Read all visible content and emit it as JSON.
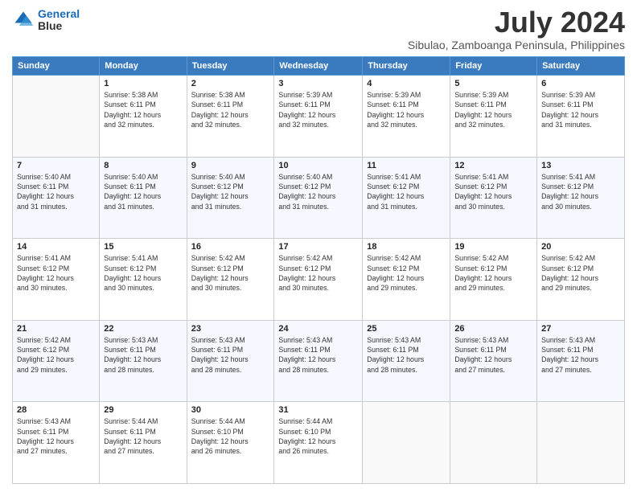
{
  "header": {
    "logo_line1": "General",
    "logo_line2": "Blue",
    "main_title": "July 2024",
    "subtitle": "Sibulao, Zamboanga Peninsula, Philippines"
  },
  "calendar": {
    "days_of_week": [
      "Sunday",
      "Monday",
      "Tuesday",
      "Wednesday",
      "Thursday",
      "Friday",
      "Saturday"
    ],
    "weeks": [
      [
        {
          "day": "",
          "info": ""
        },
        {
          "day": "1",
          "info": "Sunrise: 5:38 AM\nSunset: 6:11 PM\nDaylight: 12 hours\nand 32 minutes."
        },
        {
          "day": "2",
          "info": "Sunrise: 5:38 AM\nSunset: 6:11 PM\nDaylight: 12 hours\nand 32 minutes."
        },
        {
          "day": "3",
          "info": "Sunrise: 5:39 AM\nSunset: 6:11 PM\nDaylight: 12 hours\nand 32 minutes."
        },
        {
          "day": "4",
          "info": "Sunrise: 5:39 AM\nSunset: 6:11 PM\nDaylight: 12 hours\nand 32 minutes."
        },
        {
          "day": "5",
          "info": "Sunrise: 5:39 AM\nSunset: 6:11 PM\nDaylight: 12 hours\nand 32 minutes."
        },
        {
          "day": "6",
          "info": "Sunrise: 5:39 AM\nSunset: 6:11 PM\nDaylight: 12 hours\nand 31 minutes."
        }
      ],
      [
        {
          "day": "7",
          "info": "Sunrise: 5:40 AM\nSunset: 6:11 PM\nDaylight: 12 hours\nand 31 minutes."
        },
        {
          "day": "8",
          "info": "Sunrise: 5:40 AM\nSunset: 6:11 PM\nDaylight: 12 hours\nand 31 minutes."
        },
        {
          "day": "9",
          "info": "Sunrise: 5:40 AM\nSunset: 6:12 PM\nDaylight: 12 hours\nand 31 minutes."
        },
        {
          "day": "10",
          "info": "Sunrise: 5:40 AM\nSunset: 6:12 PM\nDaylight: 12 hours\nand 31 minutes."
        },
        {
          "day": "11",
          "info": "Sunrise: 5:41 AM\nSunset: 6:12 PM\nDaylight: 12 hours\nand 31 minutes."
        },
        {
          "day": "12",
          "info": "Sunrise: 5:41 AM\nSunset: 6:12 PM\nDaylight: 12 hours\nand 30 minutes."
        },
        {
          "day": "13",
          "info": "Sunrise: 5:41 AM\nSunset: 6:12 PM\nDaylight: 12 hours\nand 30 minutes."
        }
      ],
      [
        {
          "day": "14",
          "info": "Sunrise: 5:41 AM\nSunset: 6:12 PM\nDaylight: 12 hours\nand 30 minutes."
        },
        {
          "day": "15",
          "info": "Sunrise: 5:41 AM\nSunset: 6:12 PM\nDaylight: 12 hours\nand 30 minutes."
        },
        {
          "day": "16",
          "info": "Sunrise: 5:42 AM\nSunset: 6:12 PM\nDaylight: 12 hours\nand 30 minutes."
        },
        {
          "day": "17",
          "info": "Sunrise: 5:42 AM\nSunset: 6:12 PM\nDaylight: 12 hours\nand 30 minutes."
        },
        {
          "day": "18",
          "info": "Sunrise: 5:42 AM\nSunset: 6:12 PM\nDaylight: 12 hours\nand 29 minutes."
        },
        {
          "day": "19",
          "info": "Sunrise: 5:42 AM\nSunset: 6:12 PM\nDaylight: 12 hours\nand 29 minutes."
        },
        {
          "day": "20",
          "info": "Sunrise: 5:42 AM\nSunset: 6:12 PM\nDaylight: 12 hours\nand 29 minutes."
        }
      ],
      [
        {
          "day": "21",
          "info": "Sunrise: 5:42 AM\nSunset: 6:12 PM\nDaylight: 12 hours\nand 29 minutes."
        },
        {
          "day": "22",
          "info": "Sunrise: 5:43 AM\nSunset: 6:11 PM\nDaylight: 12 hours\nand 28 minutes."
        },
        {
          "day": "23",
          "info": "Sunrise: 5:43 AM\nSunset: 6:11 PM\nDaylight: 12 hours\nand 28 minutes."
        },
        {
          "day": "24",
          "info": "Sunrise: 5:43 AM\nSunset: 6:11 PM\nDaylight: 12 hours\nand 28 minutes."
        },
        {
          "day": "25",
          "info": "Sunrise: 5:43 AM\nSunset: 6:11 PM\nDaylight: 12 hours\nand 28 minutes."
        },
        {
          "day": "26",
          "info": "Sunrise: 5:43 AM\nSunset: 6:11 PM\nDaylight: 12 hours\nand 27 minutes."
        },
        {
          "day": "27",
          "info": "Sunrise: 5:43 AM\nSunset: 6:11 PM\nDaylight: 12 hours\nand 27 minutes."
        }
      ],
      [
        {
          "day": "28",
          "info": "Sunrise: 5:43 AM\nSunset: 6:11 PM\nDaylight: 12 hours\nand 27 minutes."
        },
        {
          "day": "29",
          "info": "Sunrise: 5:44 AM\nSunset: 6:11 PM\nDaylight: 12 hours\nand 27 minutes."
        },
        {
          "day": "30",
          "info": "Sunrise: 5:44 AM\nSunset: 6:10 PM\nDaylight: 12 hours\nand 26 minutes."
        },
        {
          "day": "31",
          "info": "Sunrise: 5:44 AM\nSunset: 6:10 PM\nDaylight: 12 hours\nand 26 minutes."
        },
        {
          "day": "",
          "info": ""
        },
        {
          "day": "",
          "info": ""
        },
        {
          "day": "",
          "info": ""
        }
      ]
    ]
  }
}
